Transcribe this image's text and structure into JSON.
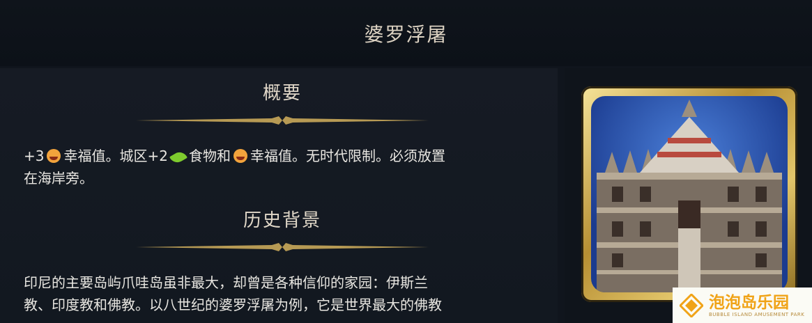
{
  "header": {
    "title": "婆罗浮屠"
  },
  "sections": {
    "overview": {
      "heading": "概要",
      "text_part1": "+3",
      "text_part2": "幸福值。城区+2",
      "text_part3": "食物和",
      "text_part4": "幸福值。无时代限制。必须放置",
      "text_line2": "在海岸旁。",
      "icons": [
        "amenity-icon",
        "food-icon",
        "amenity-icon"
      ]
    },
    "history": {
      "heading": "历史背景",
      "line1": "印尼的主要岛屿爪哇岛虽非最大，却曾是各种信仰的家园：伊斯兰",
      "line2": "教、印度教和佛教。以八世纪的婆罗浮屠为例，它是世界最大的佛教"
    }
  },
  "portrait": {
    "icon": "borobudur-wonder-icon"
  },
  "watermark": {
    "main": "泡泡岛乐园",
    "sub": "BUBBLE ISLAND AMUSEMENT PARK"
  },
  "colors": {
    "background": "#10151d",
    "heading": "#e0d7c8",
    "text": "#e8e6e1",
    "gold": "#d8b765",
    "watermark_orange": "#f0a317"
  }
}
